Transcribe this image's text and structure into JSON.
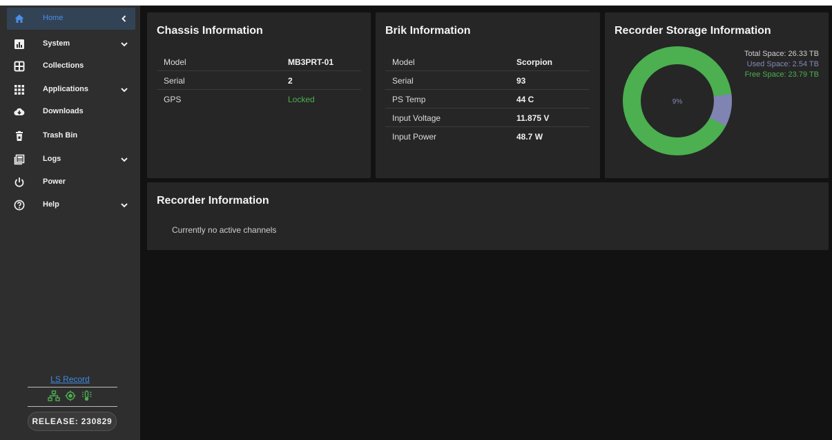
{
  "sidebar": {
    "items": [
      {
        "label": "Home",
        "icon": "home-icon",
        "expandable": false,
        "active": true
      },
      {
        "label": "System",
        "icon": "bar-chart-icon",
        "expandable": true
      },
      {
        "label": "Collections",
        "icon": "grid-box-icon",
        "expandable": false
      },
      {
        "label": "Applications",
        "icon": "apps-grid-icon",
        "expandable": true
      },
      {
        "label": "Downloads",
        "icon": "cloud-download-icon",
        "expandable": false
      },
      {
        "label": "Trash Bin",
        "icon": "trash-icon",
        "expandable": false
      },
      {
        "label": "Logs",
        "icon": "logs-icon",
        "expandable": true
      },
      {
        "label": "Power",
        "icon": "power-icon",
        "expandable": false
      },
      {
        "label": "Help",
        "icon": "help-icon",
        "expandable": true
      }
    ],
    "footer": {
      "app_link": "LS Record",
      "status_icons": [
        "network-icon",
        "gps-target-icon",
        "temperature-icon"
      ],
      "release": "RELEASE: 230829"
    }
  },
  "chassis": {
    "title": "Chassis Information",
    "rows": [
      {
        "key": "Model",
        "value": "MB3PRT-01"
      },
      {
        "key": "Serial",
        "value": "2"
      },
      {
        "key": "GPS",
        "value": "Locked"
      }
    ]
  },
  "brik": {
    "title": "Brik Information",
    "rows": [
      {
        "key": "Model",
        "value": "Scorpion"
      },
      {
        "key": "Serial",
        "value": "93"
      },
      {
        "key": "PS Temp",
        "value": "44 C"
      },
      {
        "key": "Input Voltage",
        "value": "11.875 V"
      },
      {
        "key": "Input Power",
        "value": "48.7 W"
      }
    ]
  },
  "storage": {
    "title": "Recorder Storage Information",
    "total": "Total Space: 26.33 TB",
    "used": "Used Space: 2.54 TB",
    "free": "Free Space: 23.79 TB",
    "percent_label": "9%",
    "used_fraction": 0.0965,
    "colors": {
      "used": "#7f84b3",
      "free": "#4caf50"
    }
  },
  "recorder": {
    "title": "Recorder Information",
    "empty_message": "Currently no active channels"
  },
  "colors": {
    "accent": "#4b8fe6",
    "ok": "#4caf50"
  }
}
